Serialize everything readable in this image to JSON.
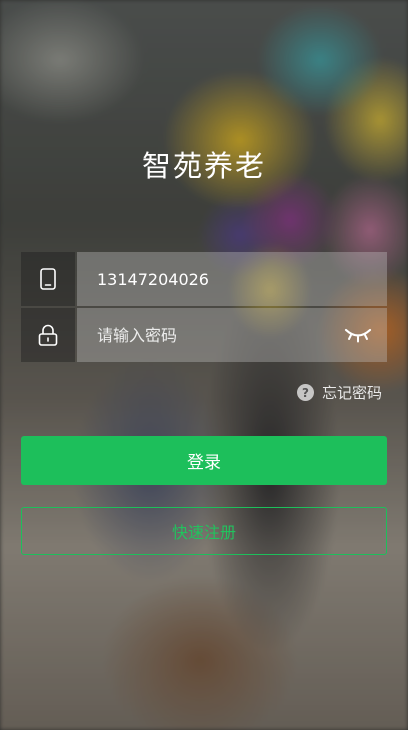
{
  "app": {
    "title": "智苑养老"
  },
  "login_form": {
    "phone_value": "13147204026",
    "password_placeholder": "请输入密码",
    "forgot_password_label": "忘记密码",
    "forgot_password_badge": "?",
    "login_label": "登录",
    "register_label": "快速注册"
  },
  "icons": {
    "phone": "phone-icon",
    "lock": "lock-icon",
    "password_visibility": "eye-closed-icon",
    "help": "question-icon"
  },
  "colors": {
    "accent": "#1dbf5b",
    "text_light": "#ffffff"
  }
}
